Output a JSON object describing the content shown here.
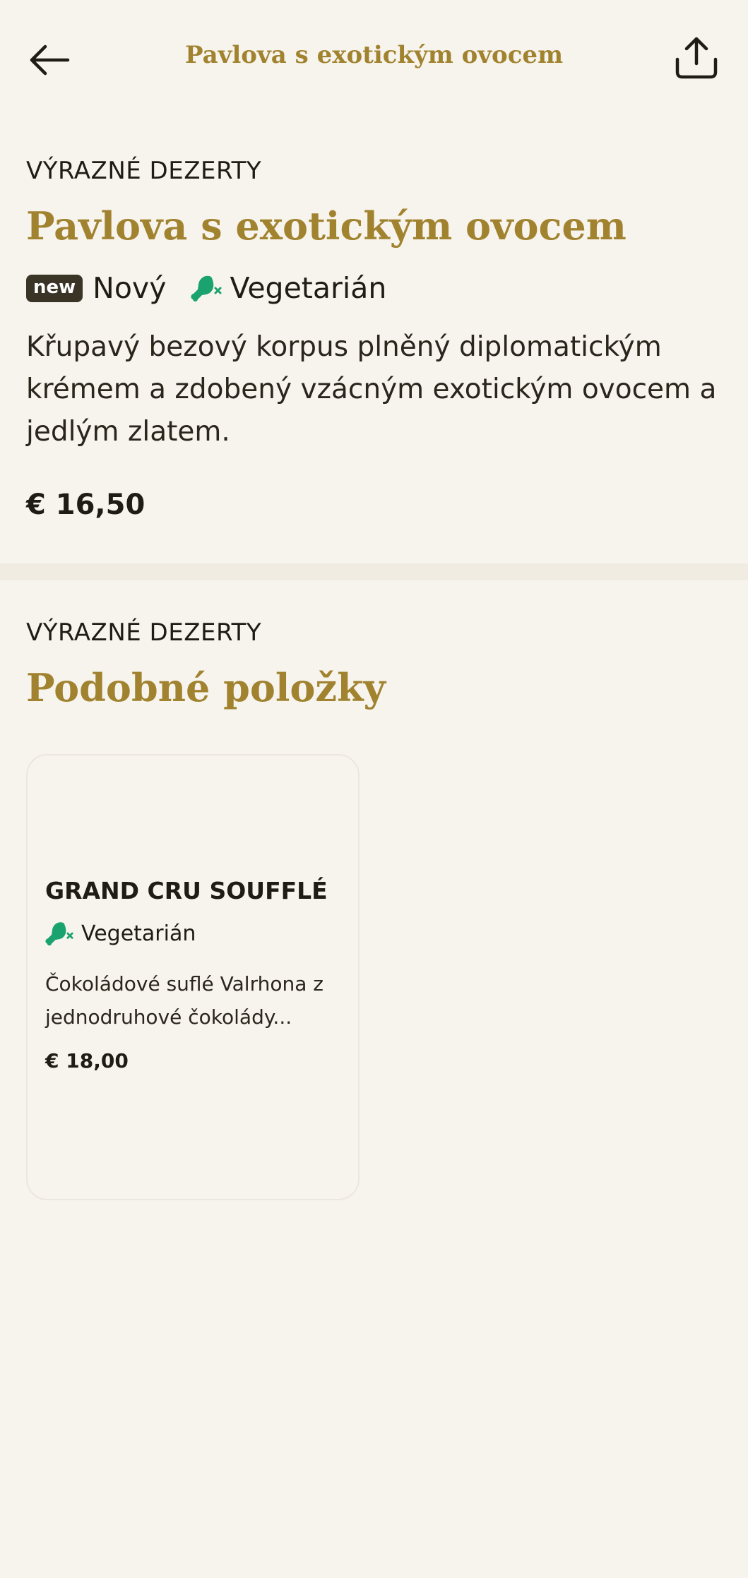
{
  "header": {
    "title": "Pavlova s exotickým ovocem"
  },
  "icons": {
    "back": "arrow-left-icon",
    "share": "share-icon",
    "vegetarian": "drumstick-crossed-icon"
  },
  "colors": {
    "accent": "#a1832f",
    "background": "#f7f4ee",
    "vegetarian": "#1aa36f",
    "badge": "#3a3427"
  },
  "item": {
    "category": "VÝRAZNÉ DEZERTY",
    "name": "Pavlova s exotickým ovocem",
    "badge": "new",
    "new_label": "Nový",
    "vegetarian_label": "Vegetarián",
    "description": "Křupavý bezový korpus plněný diplomatickým krémem a zdobený vzácným exotickým ovocem a jedlým zlatem.",
    "price": "€ 16,50"
  },
  "similar": {
    "category": "VÝRAZNÉ DEZERTY",
    "title": "Podobné položky",
    "items": [
      {
        "name": "GRAND CRU SOUFFLÉ",
        "tag": "Vegetarián",
        "description": "Čokoládové suflé Valrhona z jednodruhové čokolády...",
        "price": "€ 18,00"
      }
    ]
  }
}
